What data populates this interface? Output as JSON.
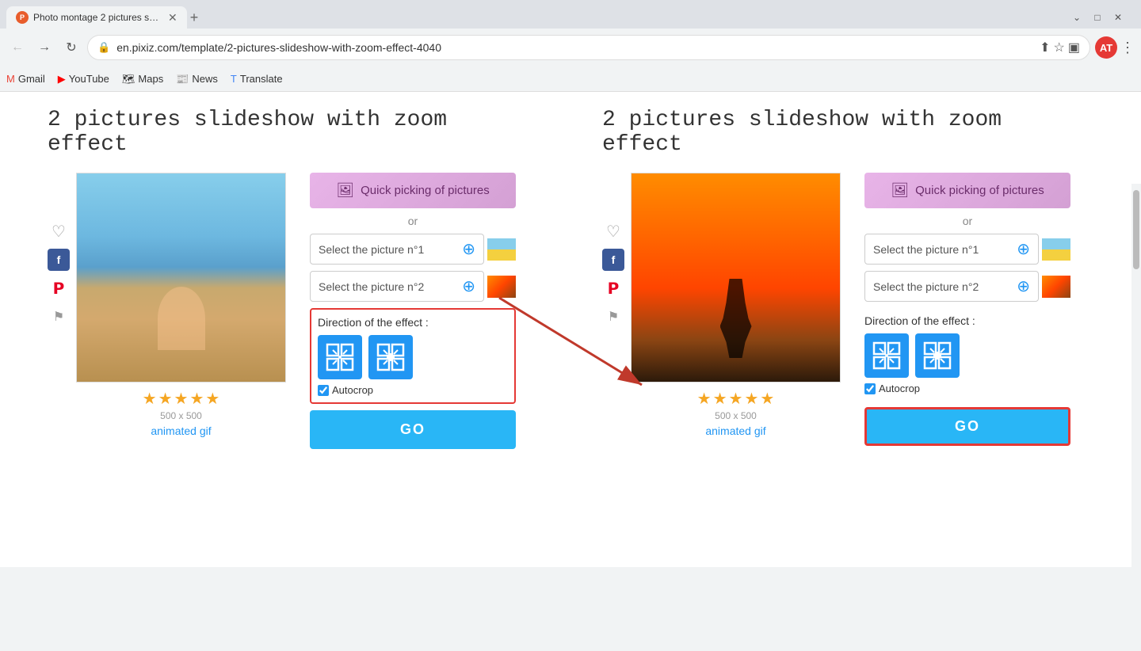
{
  "browser": {
    "tab_title": "Photo montage 2 pictures slides...",
    "url": "en.pixiz.com/template/2-pictures-slideshow-with-zoom-effect-4040",
    "bookmarks": [
      "Gmail",
      "YouTube",
      "Maps",
      "News",
      "Translate"
    ],
    "avatar_letter": "AT"
  },
  "left_section": {
    "title": "2 pictures slideshow with zoom effect",
    "quick_pick_label": "Quick picking of pictures",
    "or_text": "or",
    "select_pic1_label": "Select the picture n°1",
    "select_pic2_label": "Select the picture n°2",
    "direction_label": "Direction of the effect :",
    "autocrop_label": "Autocrop",
    "go_label": "GO",
    "size_text": "500 x 500",
    "animated_gif_text": "animated gif"
  },
  "right_section": {
    "title": "2 pictures slideshow with zoom effect",
    "quick_pick_label": "Quick picking of pictures",
    "or_text": "or",
    "select_pic1_label": "Select the picture n°1",
    "select_pic2_label": "Select the picture n°2",
    "direction_label": "Direction of the effect :",
    "autocrop_label": "Autocrop",
    "go_label": "GO",
    "size_text": "500 x 500",
    "animated_gif_text": "animated gif"
  },
  "colors": {
    "accent_blue": "#29b6f6",
    "highlight_red": "#e53935",
    "purple_btn": "#d4a0d4",
    "star_color": "#f5a623"
  }
}
